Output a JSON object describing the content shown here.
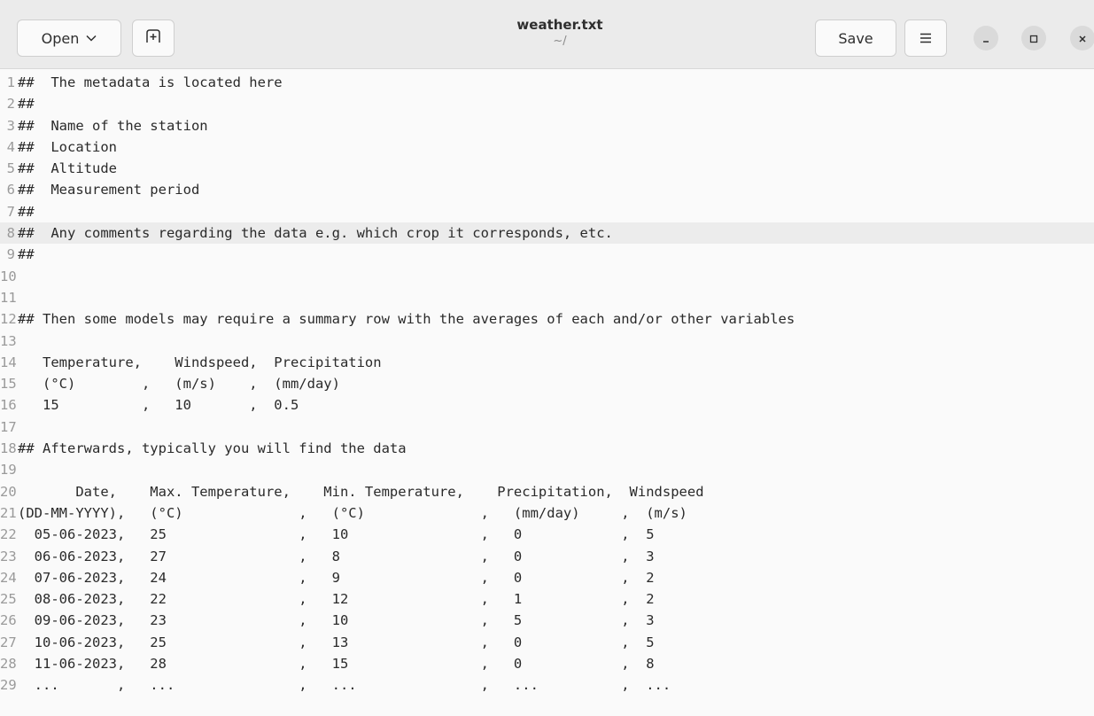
{
  "header": {
    "open_label": "Open",
    "save_label": "Save",
    "title": "weather.txt",
    "subtitle": "~/"
  },
  "icons": {
    "open_dropdown": "chevron-down-icon",
    "new_document": "new-tab-icon",
    "menu": "hamburger-menu-icon",
    "minimize": "minimize-icon",
    "maximize": "maximize-icon",
    "close": "close-icon"
  },
  "editor": {
    "current_line": 8,
    "lines": [
      {
        "n": "1",
        "text": "##  The metadata is located here"
      },
      {
        "n": "2",
        "text": "##"
      },
      {
        "n": "3",
        "text": "##  Name of the station"
      },
      {
        "n": "4",
        "text": "##  Location"
      },
      {
        "n": "5",
        "text": "##  Altitude"
      },
      {
        "n": "6",
        "text": "##  Measurement period"
      },
      {
        "n": "7",
        "text": "##"
      },
      {
        "n": "8",
        "text": "##  Any comments regarding the data e.g. which crop it corresponds, etc."
      },
      {
        "n": "9",
        "text": "##"
      },
      {
        "n": "10",
        "text": ""
      },
      {
        "n": "11",
        "text": ""
      },
      {
        "n": "12",
        "text": "## Then some models may require a summary row with the averages of each and/or other variables"
      },
      {
        "n": "13",
        "text": ""
      },
      {
        "n": "14",
        "text": "   Temperature,    Windspeed,  Precipitation"
      },
      {
        "n": "15",
        "text": "   (°C)        ,   (m/s)    ,  (mm/day)"
      },
      {
        "n": "16",
        "text": "   15          ,   10       ,  0.5"
      },
      {
        "n": "17",
        "text": ""
      },
      {
        "n": "18",
        "text": "## Afterwards, typically you will find the data"
      },
      {
        "n": "19",
        "text": ""
      },
      {
        "n": "20",
        "text": "       Date,    Max. Temperature,    Min. Temperature,    Precipitation,  Windspeed"
      },
      {
        "n": "21",
        "text": "(DD-MM-YYYY),   (°C)              ,   (°C)              ,   (mm/day)     ,  (m/s)"
      },
      {
        "n": "22",
        "text": "  05-06-2023,   25                ,   10                ,   0            ,  5"
      },
      {
        "n": "23",
        "text": "  06-06-2023,   27                ,   8                 ,   0            ,  3"
      },
      {
        "n": "24",
        "text": "  07-06-2023,   24                ,   9                 ,   0            ,  2"
      },
      {
        "n": "25",
        "text": "  08-06-2023,   22                ,   12                ,   1            ,  2"
      },
      {
        "n": "26",
        "text": "  09-06-2023,   23                ,   10                ,   5            ,  3"
      },
      {
        "n": "27",
        "text": "  10-06-2023,   25                ,   13                ,   0            ,  5"
      },
      {
        "n": "28",
        "text": "  11-06-2023,   28                ,   15                ,   0            ,  8"
      },
      {
        "n": "29",
        "text": "  ...       ,   ...               ,   ...               ,   ...          ,  ..."
      }
    ]
  }
}
